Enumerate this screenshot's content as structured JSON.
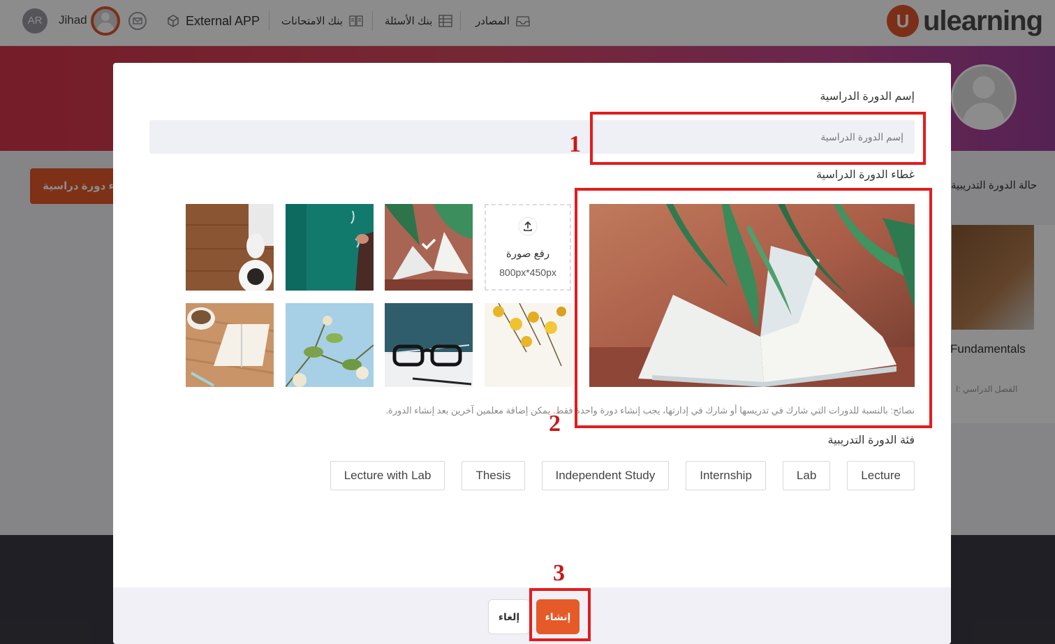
{
  "topbar": {
    "avatar_initials": "AR",
    "user_name": "Jihad",
    "external_app": "External APP",
    "exam_bank": "بنك الامتحانات",
    "question_bank": "بنك الأسئلة",
    "resources": "المصادر",
    "logo_mark": "U",
    "logo_text": "ulearning"
  },
  "background": {
    "create_course_button": "إنشاء دورة دراسية",
    "course_status_label": "حالة الدورة التدريبية",
    "course_card_title": "Fundamentals",
    "course_card_subtitle": "الفصل الدراسي :ا"
  },
  "modal": {
    "course_name_label": "إسم الدورة الدراسية",
    "course_name_placeholder": "إسم الدورة الدراسية",
    "course_name_value": "",
    "cover_label": "غطاء الدورة الدراسية",
    "upload_title": "رفع صورة",
    "upload_dimensions": "800px*450px",
    "tips": "نصائح: بالنسبة للدورات التي شارك في تدريسها أو شارك في إدارتها، يجب إنشاء دورة واحدة فقط. يمكن إضافة معلمين آخرين بعد إنشاء الدورة.",
    "category_label": "فئة الدورة التدريبية",
    "categories": [
      "Lecture",
      "Lab",
      "Internship",
      "Independent Study",
      "Thesis",
      "Lecture with Lab"
    ],
    "cancel_button": "إلغاء",
    "create_button": "إنشاء",
    "selected_cover": "open-book-leaves"
  },
  "annotations": [
    "1",
    "2",
    "3"
  ],
  "colors": {
    "accent": "#e65a2a",
    "annotation": "#e31c1c",
    "banner_start": "#d5364a",
    "banner_end": "#9b3f9a"
  }
}
